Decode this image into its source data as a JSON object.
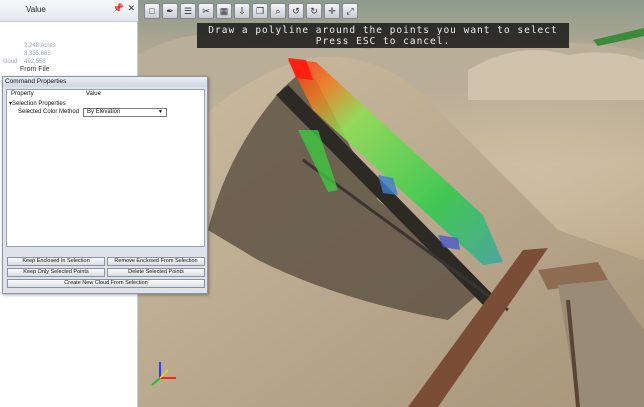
{
  "left_panel": {
    "header_value_label": "Value",
    "pin_icon": "pin-icon",
    "close_icon": "close-icon",
    "rows": [
      {
        "label": "",
        "value": ""
      },
      {
        "label": "",
        "value": ""
      },
      {
        "label": "",
        "value": "3,248 Acres"
      },
      {
        "label": "",
        "value": "3,335,665"
      },
      {
        "label": "cloud",
        "value": "492,558"
      }
    ],
    "from_file": "From File"
  },
  "viewport": {
    "toolbar_icons": [
      "box-select-icon",
      "polyline-select-icon",
      "layers-icon",
      "cut-icon",
      "grid-icon",
      "export-icon",
      "copy-icon",
      "zoom-icon",
      "rotate-left-icon",
      "rotate-right-icon",
      "pan-icon",
      "expand-icon"
    ],
    "instruction_line1": "Draw a polyline around the points you want to select",
    "instruction_line2": "Press ESC to cancel."
  },
  "command_dialog": {
    "title": "Command Properties",
    "col_property": "Property",
    "col_value": "Value",
    "section": "Selection Properties",
    "property_label": "Selected Color Method",
    "property_value": "By Elevation",
    "buttons": {
      "keep_enclosed": "Keep Enclosed In Selection",
      "remove_enclosed": "Remove Enclosed From Selection",
      "keep_only": "Keep Only Selected Points",
      "delete_selected": "Delete Selected Points",
      "create_cloud": "Create New Cloud From Selection"
    }
  }
}
